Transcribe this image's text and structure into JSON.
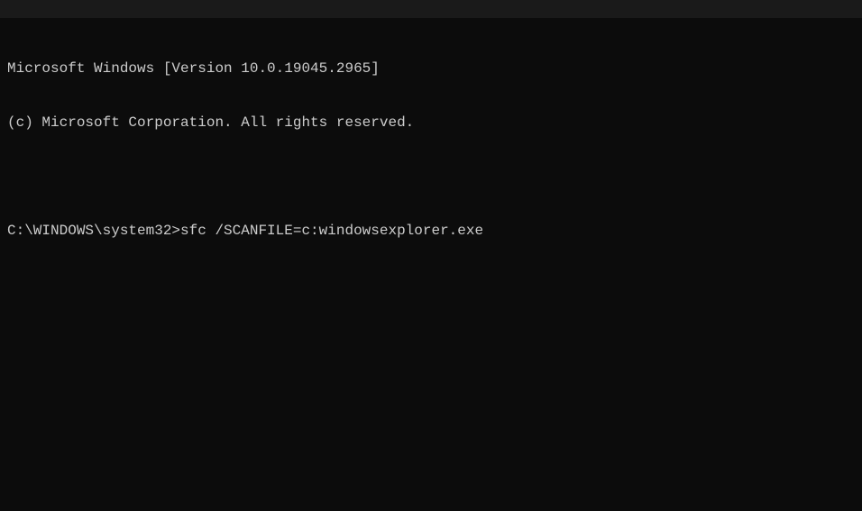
{
  "terminal": {
    "header_line_1": "Microsoft Windows [Version 10.0.19045.2965]",
    "header_line_2": "(c) Microsoft Corporation. All rights reserved.",
    "blank": "",
    "prompt": "C:\\WINDOWS\\system32>",
    "command": "sfc /SCANFILE=c:windowsexplorer.exe"
  }
}
